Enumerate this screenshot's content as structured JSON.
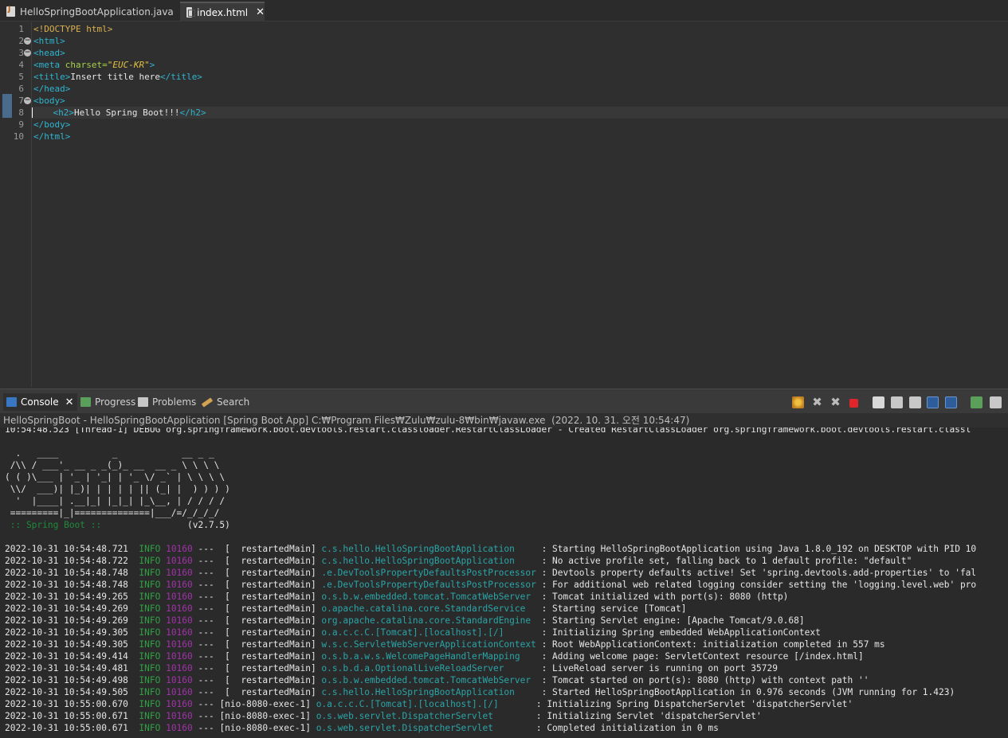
{
  "editor_tabs": [
    {
      "label": "HelloSpringBootApplication.java",
      "active": false
    },
    {
      "label": "index.html",
      "active": true,
      "close": "✕"
    }
  ],
  "editor": {
    "lines": [
      {
        "num": "1",
        "fold": false
      },
      {
        "num": "2",
        "fold": true
      },
      {
        "num": "3",
        "fold": true
      },
      {
        "num": "4",
        "fold": false
      },
      {
        "num": "5",
        "fold": false
      },
      {
        "num": "6",
        "fold": false
      },
      {
        "num": "7",
        "fold": true
      },
      {
        "num": "8",
        "fold": false,
        "current": true
      },
      {
        "num": "9",
        "fold": false
      },
      {
        "num": "10",
        "fold": false
      }
    ],
    "code": {
      "l1": {
        "open": "<!DOCTYPE",
        "name": " html",
        "close": ">"
      },
      "l2": "<html>",
      "l3": "<head>",
      "l4": {
        "tag": "<meta",
        "attr": " charset=",
        "val": "\"EUC-KR\"",
        "close": ">"
      },
      "l5": {
        "open": "<title>",
        "text": "Insert title here",
        "close": "</title>"
      },
      "l6": "</head>",
      "l7": "<body>",
      "l8": {
        "indent": "    ",
        "open": "<h2>",
        "text": "Hello Spring Boot!!!",
        "close": "</h2>"
      },
      "l9": "</body>",
      "l10": "</html>"
    }
  },
  "console": {
    "tabs": [
      {
        "label": "Console",
        "close": "✕"
      },
      {
        "label": "Progress"
      },
      {
        "label": "Problems"
      },
      {
        "label": "Search"
      }
    ],
    "toolbar_icons": [
      "sync-icon",
      "remove-launch-icon",
      "remove-all-icon",
      "terminate-icon",
      "clear-console-icon",
      "scroll-lock-icon",
      "word-wrap-icon",
      "pin-console-icon",
      "show-on-output-icon",
      "open-console-icon",
      "display-console-icon"
    ],
    "description": "HelloSpringBoot - HelloSpringBootApplication [Spring Boot App] C:₩Program Files₩Zulu₩zulu-8₩bin₩javaw.exe  (2022. 10. 31. 오전 10:54:47)",
    "top_cut": "10:54:48.523 [Thread-1] DEBUG org.springframework.boot.devtools.restart.classloader.RestartClassLoader - Created RestartClassLoader org.springframework.boot.devtools.restart.classl",
    "banner": [
      "  .   ____          _            __ _ _",
      " /\\\\ / ___'_ __ _ _(_)_ __  __ _ \\ \\ \\ \\",
      "( ( )\\___ | '_ | '_| | '_ \\/ _` | \\ \\ \\ \\",
      " \\\\/  ___)| |_)| | | | | || (_| |  ) ) ) )",
      "  '  |____| .__|_| |_|_| |_\\__, | / / / /",
      " =========|_|==============|___/=/_/_/_/"
    ],
    "spring_label": " :: Spring Boot :: ",
    "spring_version": "               (v2.7.5)",
    "logs": [
      {
        "ts": "2022-10-31 10:54:48.721",
        "lvl": "INFO",
        "pid": "10160",
        "thread": "---  [  restartedMain]",
        "logger": "c.s.hello.HelloSpringBootApplication    ",
        "msg": " : Starting HelloSpringBootApplication using Java 1.8.0_192 on DESKTOP with PID 10"
      },
      {
        "ts": "2022-10-31 10:54:48.722",
        "lvl": "INFO",
        "pid": "10160",
        "thread": "---  [  restartedMain]",
        "logger": "c.s.hello.HelloSpringBootApplication    ",
        "msg": " : No active profile set, falling back to 1 default profile: \"default\""
      },
      {
        "ts": "2022-10-31 10:54:48.748",
        "lvl": "INFO",
        "pid": "10160",
        "thread": "---  [  restartedMain]",
        "logger": ".e.DevToolsPropertyDefaultsPostProcessor",
        "msg": " : Devtools property defaults active! Set 'spring.devtools.add-properties' to 'fal"
      },
      {
        "ts": "2022-10-31 10:54:48.748",
        "lvl": "INFO",
        "pid": "10160",
        "thread": "---  [  restartedMain]",
        "logger": ".e.DevToolsPropertyDefaultsPostProcessor",
        "msg": " : For additional web related logging consider setting the 'logging.level.web' pro"
      },
      {
        "ts": "2022-10-31 10:54:49.265",
        "lvl": "INFO",
        "pid": "10160",
        "thread": "---  [  restartedMain]",
        "logger": "o.s.b.w.embedded.tomcat.TomcatWebServer ",
        "msg": " : Tomcat initialized with port(s): 8080 (http)"
      },
      {
        "ts": "2022-10-31 10:54:49.269",
        "lvl": "INFO",
        "pid": "10160",
        "thread": "---  [  restartedMain]",
        "logger": "o.apache.catalina.core.StandardService  ",
        "msg": " : Starting service [Tomcat]"
      },
      {
        "ts": "2022-10-31 10:54:49.269",
        "lvl": "INFO",
        "pid": "10160",
        "thread": "---  [  restartedMain]",
        "logger": "org.apache.catalina.core.StandardEngine ",
        "msg": " : Starting Servlet engine: [Apache Tomcat/9.0.68]"
      },
      {
        "ts": "2022-10-31 10:54:49.305",
        "lvl": "INFO",
        "pid": "10160",
        "thread": "---  [  restartedMain]",
        "logger": "o.a.c.c.C.[Tomcat].[localhost].[/]      ",
        "msg": " : Initializing Spring embedded WebApplicationContext"
      },
      {
        "ts": "2022-10-31 10:54:49.305",
        "lvl": "INFO",
        "pid": "10160",
        "thread": "---  [  restartedMain]",
        "logger": "w.s.c.ServletWebServerApplicationContext",
        "msg": " : Root WebApplicationContext: initialization completed in 557 ms"
      },
      {
        "ts": "2022-10-31 10:54:49.414",
        "lvl": "INFO",
        "pid": "10160",
        "thread": "---  [  restartedMain]",
        "logger": "o.s.b.a.w.s.WelcomePageHandlerMapping   ",
        "msg": " : Adding welcome page: ServletContext resource [/index.html]"
      },
      {
        "ts": "2022-10-31 10:54:49.481",
        "lvl": "INFO",
        "pid": "10160",
        "thread": "---  [  restartedMain]",
        "logger": "o.s.b.d.a.OptionalLiveReloadServer      ",
        "msg": " : LiveReload server is running on port 35729"
      },
      {
        "ts": "2022-10-31 10:54:49.498",
        "lvl": "INFO",
        "pid": "10160",
        "thread": "---  [  restartedMain]",
        "logger": "o.s.b.w.embedded.tomcat.TomcatWebServer ",
        "msg": " : Tomcat started on port(s): 8080 (http) with context path ''"
      },
      {
        "ts": "2022-10-31 10:54:49.505",
        "lvl": "INFO",
        "pid": "10160",
        "thread": "---  [  restartedMain]",
        "logger": "c.s.hello.HelloSpringBootApplication    ",
        "msg": " : Started HelloSpringBootApplication in 0.976 seconds (JVM running for 1.423)"
      },
      {
        "ts": "2022-10-31 10:55:00.670",
        "lvl": "INFO",
        "pid": "10160",
        "thread": "--- [nio-8080-exec-1]",
        "logger": "o.a.c.c.C.[Tomcat].[localhost].[/]      ",
        "msg": " : Initializing Spring DispatcherServlet 'dispatcherServlet'"
      },
      {
        "ts": "2022-10-31 10:55:00.671",
        "lvl": "INFO",
        "pid": "10160",
        "thread": "--- [nio-8080-exec-1]",
        "logger": "o.s.web.servlet.DispatcherServlet       ",
        "msg": " : Initializing Servlet 'dispatcherServlet'"
      },
      {
        "ts": "2022-10-31 10:55:00.671",
        "lvl": "INFO",
        "pid": "10160",
        "thread": "--- [nio-8080-exec-1]",
        "logger": "o.s.web.servlet.DispatcherServlet       ",
        "msg": " : Completed initialization in 0 ms"
      }
    ]
  }
}
